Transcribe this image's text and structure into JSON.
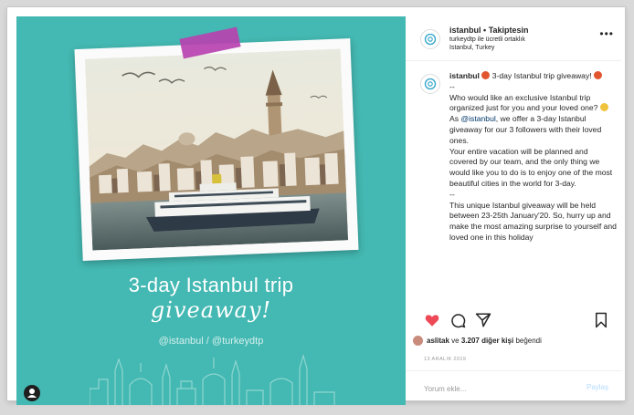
{
  "post_image": {
    "title_line": "3-day Istanbul trip",
    "script_line": "giveaway!",
    "handles": "@istanbul / @turkeydtp"
  },
  "header": {
    "username": "istanbul",
    "separator": "•",
    "follow_label": "Takiptesin",
    "partnership": "turkeydtp ile ücretli ortaklık",
    "location": "Istanbul, Turkey",
    "more_icon": "more-horizontal-icon"
  },
  "caption": {
    "username": "istanbul",
    "headline": "3-day Istanbul trip giveaway!",
    "sep1": "--",
    "para1": "Who would like an exclusive Istanbul trip organized just for you and your loved one?",
    "para2_prefix": "As",
    "para2_mention": "@istanbul",
    "para2_rest": ", we offer a 3-day Istanbul giveaway for our 3 followers with their loved ones.",
    "para3": "Your entire vacation will be planned and covered by our team, and the only thing we would like you to do is to enjoy one of the most beautiful cities in the world for 3-day.",
    "sep2": "--",
    "para4": "This unique Istanbul giveaway will be held between 23-25th January'20. So, hurry up and make the most amazing surprise to yourself and loved one in this holiday"
  },
  "actions": {
    "like_icon": "heart-icon",
    "comment_icon": "comment-icon",
    "share_icon": "share-icon",
    "save_icon": "bookmark-icon",
    "like_color": "#ed4956"
  },
  "likes": {
    "user": "aslitak",
    "joiner": "ve",
    "others": "3.207 diğer kişi",
    "suffix": "beğendi"
  },
  "date": "13 ARALIK 2019",
  "comment": {
    "placeholder": "Yorum ekle...",
    "post_label": "Paylaş"
  },
  "colors": {
    "post_background": "#44b8b2",
    "tape": "#b742b0",
    "link": "#00376b"
  }
}
